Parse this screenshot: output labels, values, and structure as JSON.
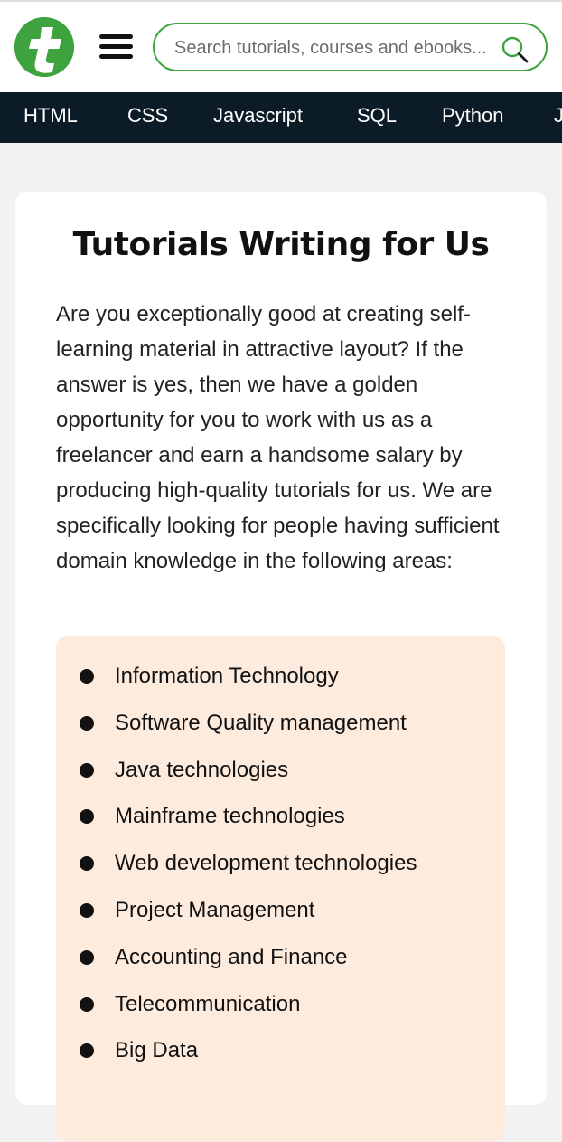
{
  "header": {
    "logo_icon": "tutorialspoint-t-logo",
    "menu_icon": "hamburger-menu-icon",
    "search": {
      "placeholder": "Search tutorials, courses and ebooks...",
      "value": "",
      "icon": "search-icon"
    }
  },
  "nav": {
    "items": [
      "HTML",
      "CSS",
      "Javascript",
      "SQL",
      "Python",
      "Java"
    ]
  },
  "content": {
    "title": "Tutorials Writing for Us",
    "intro": "Are you exceptionally good at creating self-learning material in attractive layout? If the answer is yes, then we have a golden opportunity for you to work with us as a freelancer and earn a handsome salary by producing high-quality tutorials for us. We are specifically looking for people having sufficient domain knowledge in the following areas:",
    "areas": [
      "Information Technology",
      "Software Quality management",
      "Java technologies",
      "Mainframe technologies",
      "Web development technologies",
      "Project Management",
      "Accounting and Finance",
      "Telecommunication",
      "Big Data"
    ]
  },
  "colors": {
    "brand_green": "#3ea33e",
    "nav_background": "#0b1c26",
    "list_background": "#fdebdd",
    "page_background": "#f2f2f2"
  }
}
